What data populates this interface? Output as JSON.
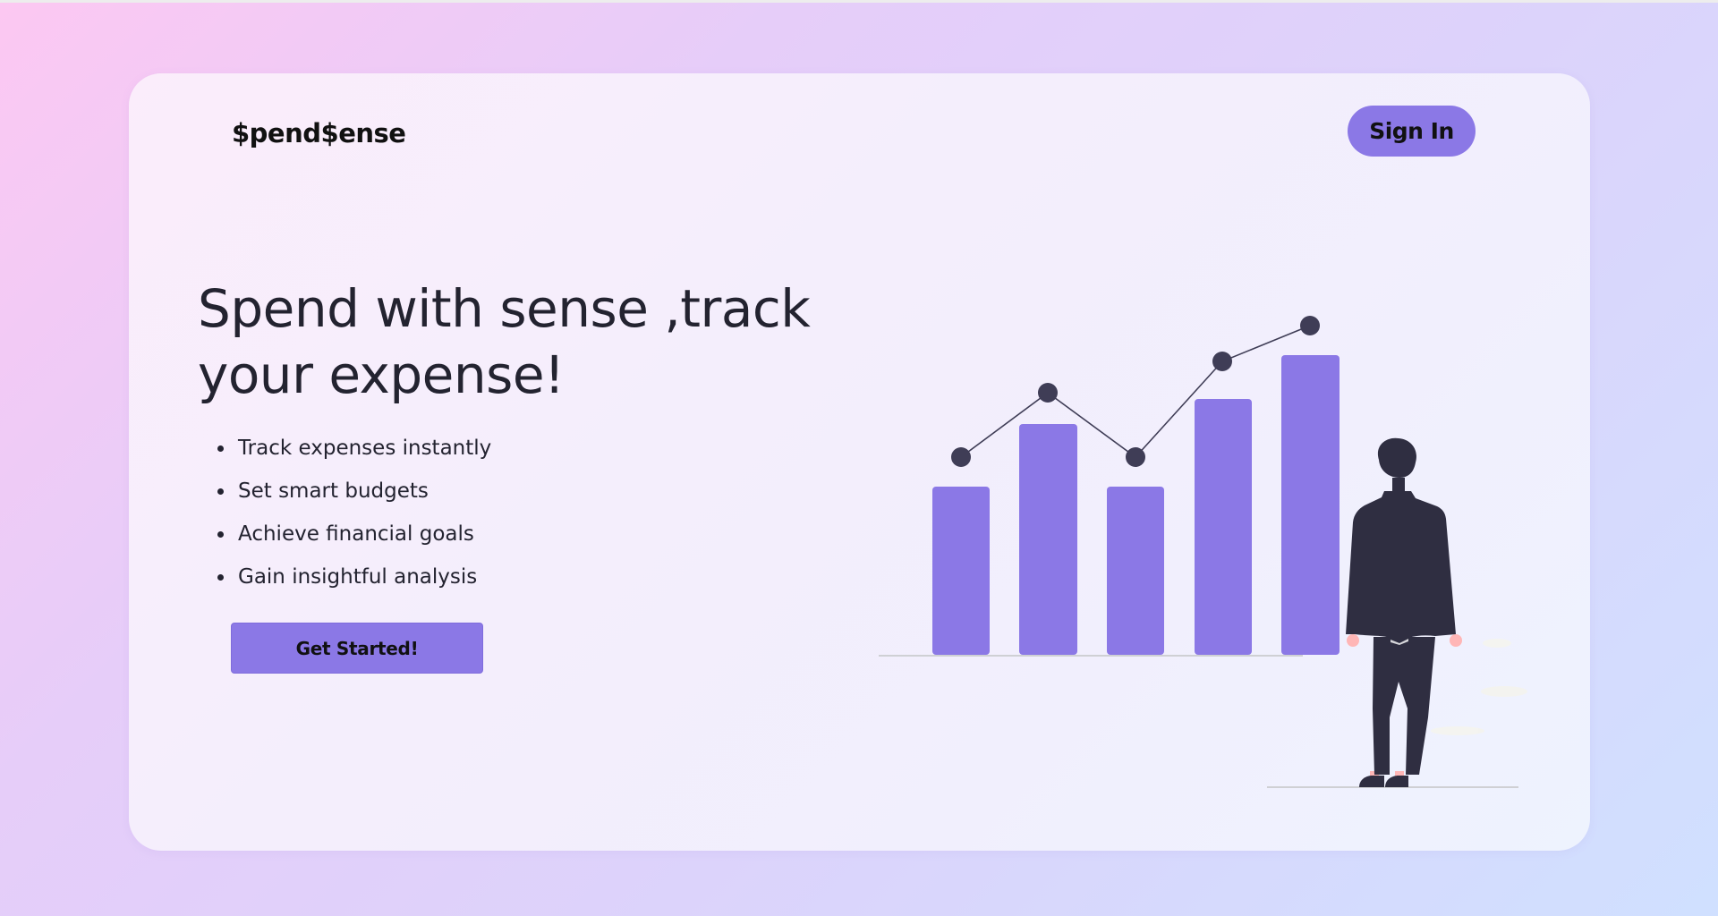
{
  "header": {
    "logo_text": "$pend$ense",
    "signin_label": "Sign In"
  },
  "hero": {
    "headline": "Spend with sense ,track your expense!",
    "features": [
      "Track expenses instantly",
      "Set smart budgets",
      "Achieve financial goals",
      "Gain insightful analysis"
    ],
    "cta_label": "Get Started!"
  },
  "colors": {
    "accent": "#8b78e6",
    "text": "#232330",
    "figure": "#2f2e41"
  }
}
